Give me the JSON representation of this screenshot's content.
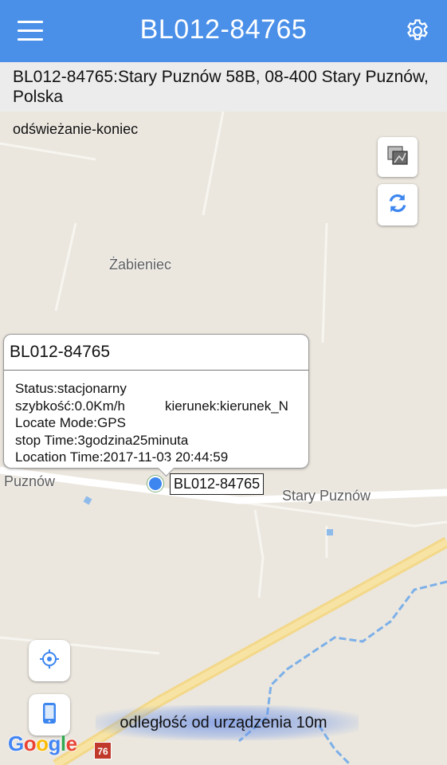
{
  "header": {
    "title": "BL012-84765",
    "menu_icon": "hamburger-menu-icon",
    "settings_icon": "gear-icon"
  },
  "address": {
    "text": "BL012-84765:Stary Puznów 58B, 08-400 Stary Puznów, Polska"
  },
  "map": {
    "refresh_status": "odświeżanie-koniec",
    "places": {
      "zabieniec": "Żabieniec",
      "puznow": "Puznów",
      "stary_puznow": "Stary Puznów"
    },
    "road_number": "76",
    "attribution": [
      "G",
      "o",
      "o",
      "g",
      "l",
      "e"
    ],
    "attribution_colors": [
      "#4285f4",
      "#ea4335",
      "#fbbc05",
      "#4285f4",
      "#34a853",
      "#ea4335"
    ]
  },
  "info_window": {
    "title": "BL012-84765",
    "status": "Status:stacjonarny",
    "speed": "szybkość:0.0Km/h",
    "direction": "kierunek:kierunek_N",
    "locate_mode": "Locate Mode:GPS",
    "stop_time": "stop Time:3godzina25minuta",
    "location_time": "Location Time:2017-11-03 20:44:59"
  },
  "device": {
    "label": "BL012-84765",
    "distance": "odległość od urządzenia 10m"
  },
  "colors": {
    "header_bg": "#4a8fe8",
    "device_dot": "#3d86f0",
    "refresh_icon": "#3d86f0"
  }
}
